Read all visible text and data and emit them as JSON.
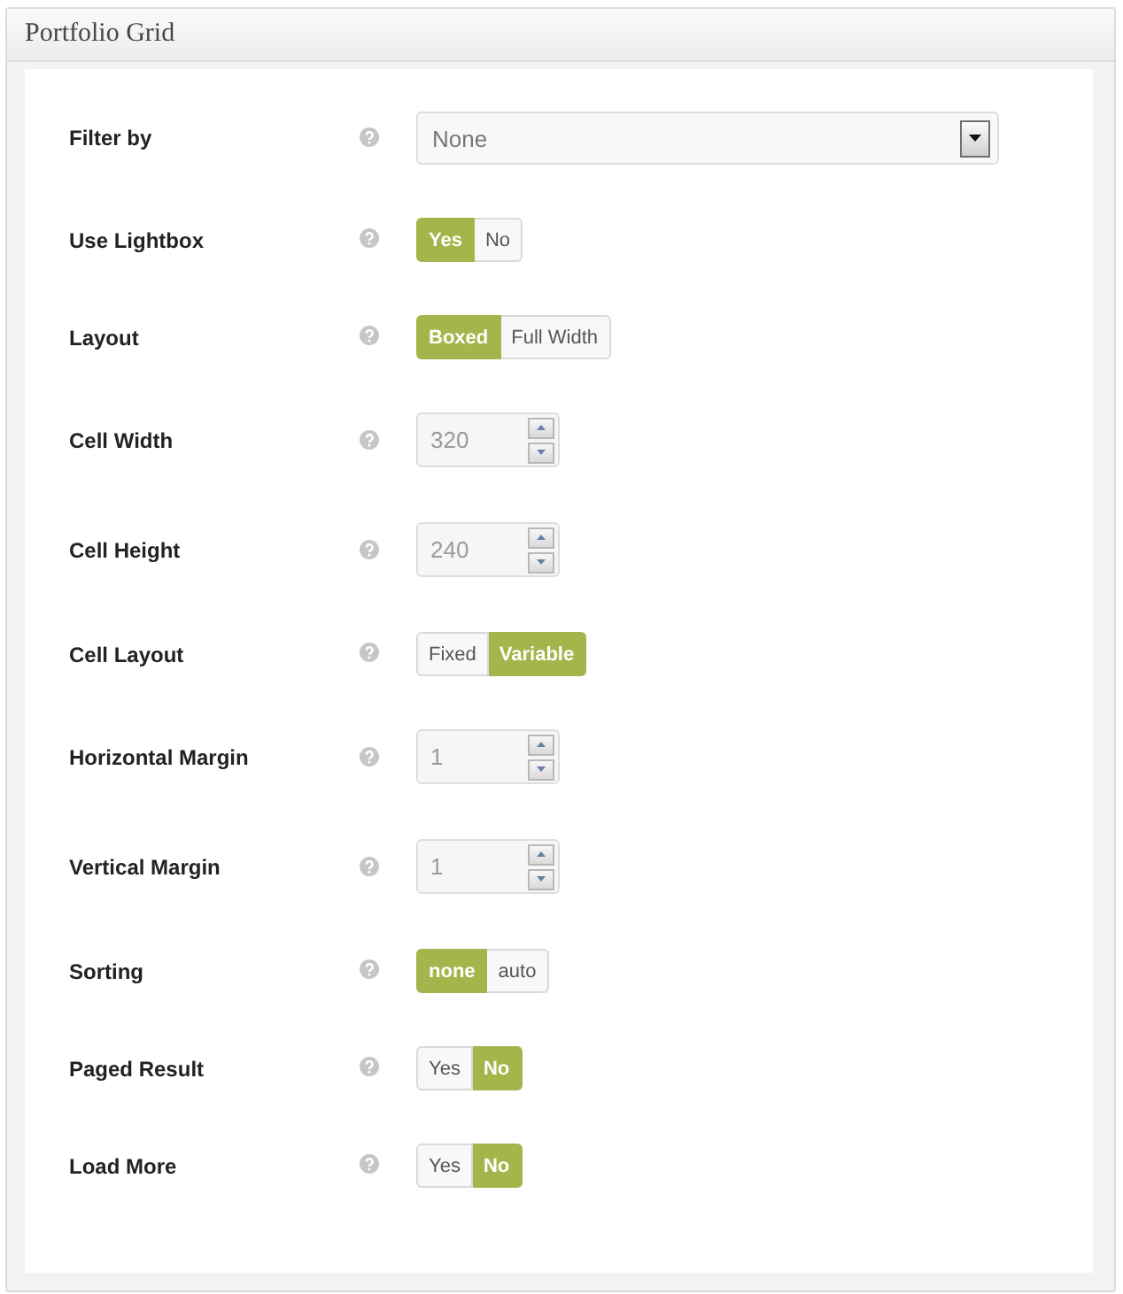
{
  "panel": {
    "title": "Portfolio Grid"
  },
  "fields": [
    {
      "kind": "select",
      "label": "Filter by",
      "value": "None"
    },
    {
      "kind": "toggle",
      "label": "Use Lightbox",
      "options": [
        {
          "label": "Yes",
          "selected": true
        },
        {
          "label": "No",
          "selected": false
        }
      ]
    },
    {
      "kind": "toggle",
      "label": "Layout",
      "options": [
        {
          "label": "Boxed",
          "selected": true
        },
        {
          "label": "Full Width",
          "selected": false
        }
      ]
    },
    {
      "kind": "spinner",
      "label": "Cell Width",
      "value": "320"
    },
    {
      "kind": "spinner",
      "label": "Cell Height",
      "value": "240"
    },
    {
      "kind": "toggle",
      "label": "Cell Layout",
      "options": [
        {
          "label": "Fixed",
          "selected": false
        },
        {
          "label": "Variable",
          "selected": true
        }
      ]
    },
    {
      "kind": "spinner",
      "label": "Horizontal Margin",
      "value": "1"
    },
    {
      "kind": "spinner",
      "label": "Vertical Margin",
      "value": "1"
    },
    {
      "kind": "toggle",
      "label": "Sorting",
      "options": [
        {
          "label": "none",
          "selected": true
        },
        {
          "label": "auto",
          "selected": false
        }
      ]
    },
    {
      "kind": "toggle",
      "label": "Paged Result",
      "options": [
        {
          "label": "Yes",
          "selected": false
        },
        {
          "label": "No",
          "selected": true
        }
      ]
    },
    {
      "kind": "toggle",
      "label": "Load More",
      "options": [
        {
          "label": "Yes",
          "selected": false
        },
        {
          "label": "No",
          "selected": true
        }
      ]
    }
  ]
}
